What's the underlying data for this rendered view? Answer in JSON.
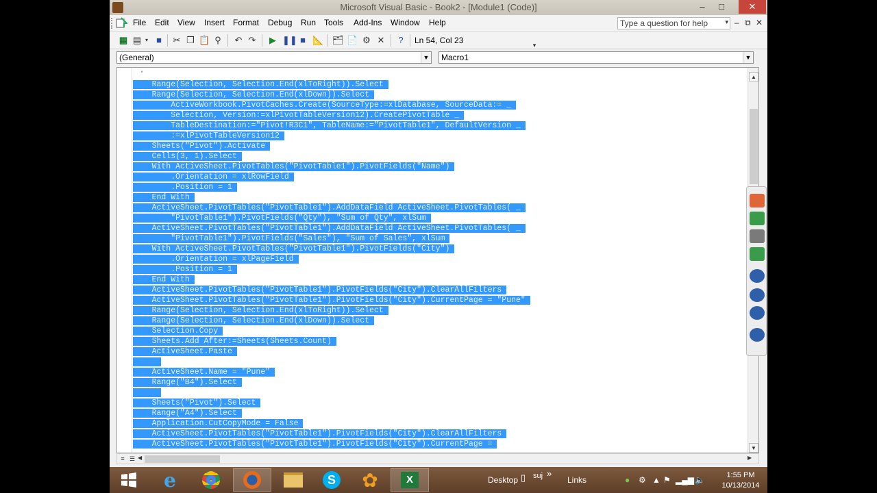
{
  "window": {
    "title": "Microsoft Visual Basic - Book2 - [Module1 (Code)]",
    "minimize": "–",
    "maximize": "□",
    "close": "✕"
  },
  "menubar": {
    "items": [
      "File",
      "Edit",
      "View",
      "Insert",
      "Format",
      "Debug",
      "Run",
      "Tools",
      "Add-Ins",
      "Window",
      "Help"
    ],
    "question_placeholder": "Type a question for help",
    "mdi_minimize": "–",
    "mdi_restore": "⧉",
    "mdi_close": "✕"
  },
  "toolbar": {
    "position": "Ln 54, Col 23"
  },
  "combos": {
    "object": "(General)",
    "procedure": "Macro1"
  },
  "code": {
    "apostrophe": "'",
    "lines": [
      "    Range(Selection, Selection.End(xlToRight)).Select ",
      "    Range(Selection, Selection.End(xlDown)).Select ",
      "        ActiveWorkbook.PivotCaches.Create(SourceType:=xlDatabase, SourceData:= _ ",
      "        Selection, Version:=xlPivotTableVersion12).CreatePivotTable _ ",
      "        TableDestination:=\"Pivot!R3C1\", TableName:=\"PivotTable1\", DefaultVersion _ ",
      "        :=xlPivotTableVersion12 ",
      "    Sheets(\"Pivot\").Activate ",
      "    Cells(3, 1).Select ",
      "    With ActiveSheet.PivotTables(\"PivotTable1\").PivotFields(\"Name\") ",
      "        .Orientation = xlRowField ",
      "        .Position = 1 ",
      "    End With ",
      "    ActiveSheet.PivotTables(\"PivotTable1\").AddDataField ActiveSheet.PivotTables( _ ",
      "        \"PivotTable1\").PivotFields(\"Qty\"), \"Sum of Qty\", xlSum ",
      "    ActiveSheet.PivotTables(\"PivotTable1\").AddDataField ActiveSheet.PivotTables( _ ",
      "        \"PivotTable1\").PivotFields(\"Sales\"), \"Sum of Sales\", xlSum ",
      "    With ActiveSheet.PivotTables(\"PivotTable1\").PivotFields(\"City\") ",
      "        .Orientation = xlPageField ",
      "        .Position = 1 ",
      "    End With ",
      "    ActiveSheet.PivotTables(\"PivotTable1\").PivotFields(\"City\").ClearAllFilters ",
      "    ActiveSheet.PivotTables(\"PivotTable1\").PivotFields(\"City\").CurrentPage = \"Pune\" ",
      "    Range(Selection, Selection.End(xlToRight)).Select ",
      "    Range(Selection, Selection.End(xlDown)).Select ",
      "    Selection.Copy ",
      "    Sheets.Add After:=Sheets(Sheets.Count) ",
      "    ActiveSheet.Paste ",
      "      ",
      "    ActiveSheet.Name = \"Pune\" ",
      "    Range(\"B4\").Select ",
      "      ",
      "    Sheets(\"Pivot\").Select ",
      "    Range(\"A4\").Select ",
      "    Application.CutCopyMode = False ",
      "    ActiveSheet.PivotTables(\"PivotTable1\").PivotFields(\"City\").ClearAllFilters ",
      "    ActiveSheet.PivotTables(\"PivotTable1\").PivotFields(\"City\").CurrentPage = "
    ]
  },
  "taskbar": {
    "desktop_label": "Desktop",
    "suj_label": "suj",
    "links_label": "Links",
    "chevron": "»",
    "time": "1:55 PM",
    "date": "10/13/2014"
  },
  "colors": {
    "selection": "#3399ff",
    "taskbar": "#6b4a32"
  }
}
